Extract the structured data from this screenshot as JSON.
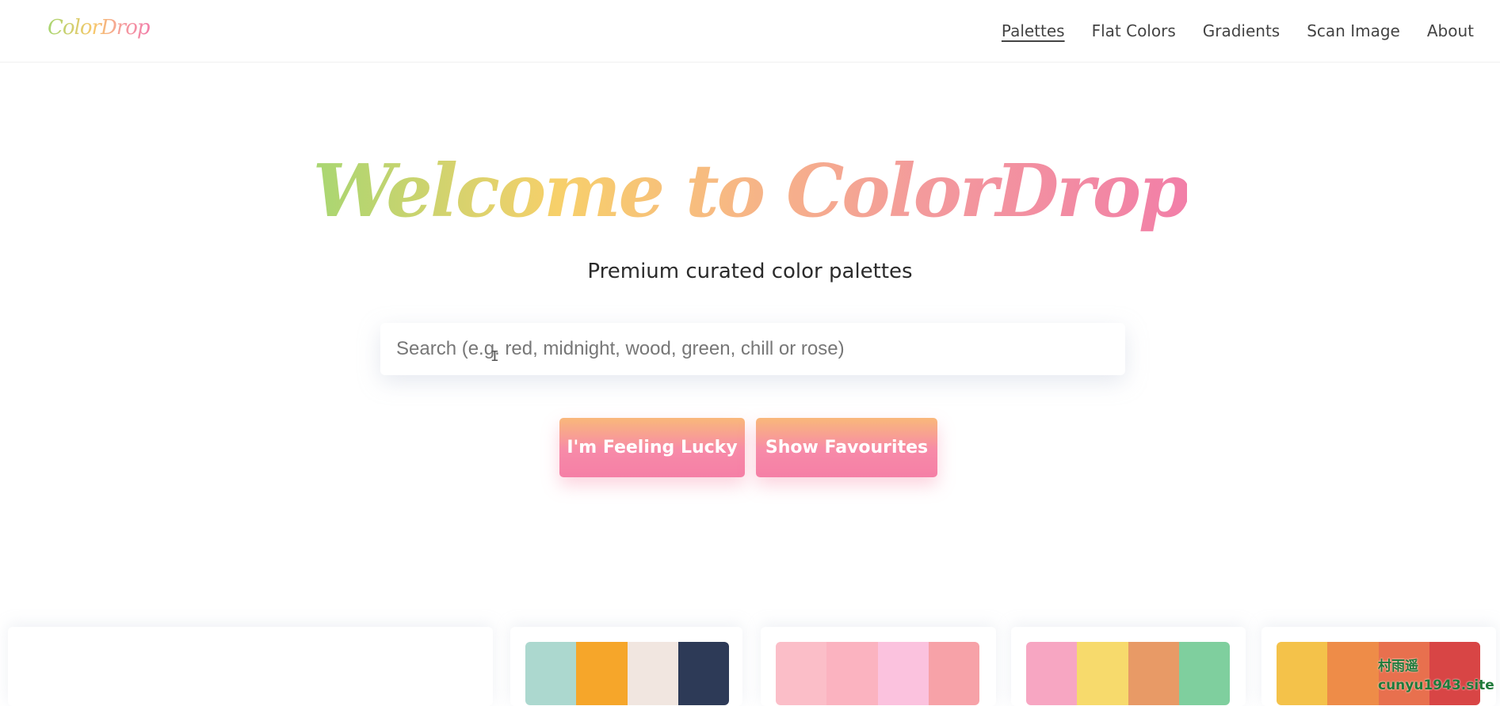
{
  "header": {
    "logo": "ColorDrop",
    "nav": [
      "Palettes",
      "Flat Colors",
      "Gradients",
      "Scan Image",
      "About"
    ],
    "active_nav": "Palettes"
  },
  "hero": {
    "title": "Welcome to ColorDrop",
    "subtitle": "Premium curated color palettes",
    "search": {
      "placeholder": "Search (e.g. red, midnight, wood, green, chill or rose)",
      "value": ""
    },
    "buttons": {
      "lucky": "I'm Feeling Lucky",
      "favourites": "Show Favourites"
    }
  },
  "palettes": [
    [
      "#acd8cf",
      "#f6a62a",
      "#f1e6e0",
      "#2d3a57"
    ],
    [
      "#fbbec8",
      "#fbb3c0",
      "#fbc2de",
      "#f7a2a8"
    ],
    [
      "#f7a6c2",
      "#f7da6c",
      "#e89a66",
      "#7fcf9e"
    ],
    [
      "#f4c24a",
      "#ee8c48",
      "#e8704e",
      "#d84545"
    ]
  ],
  "watermark": "村雨遥\ncunyu1943.site",
  "colors": {
    "gradient_start": "#a8d672",
    "gradient_mid": "#f7c86a",
    "gradient_end": "#f27fa8",
    "button_top": "#f9b87a",
    "button_bottom": "#f57fa6"
  }
}
